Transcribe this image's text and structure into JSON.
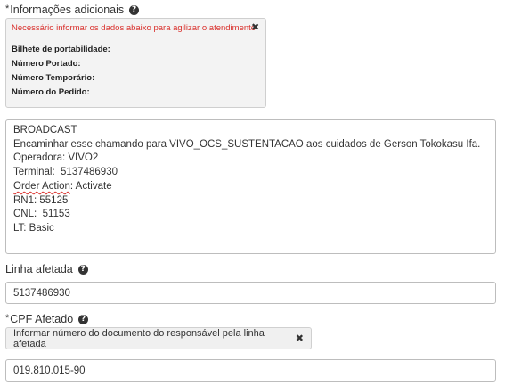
{
  "additional_info": {
    "label": "Informações adicionais",
    "required_mark": "*",
    "help_icon": "question-circle-icon",
    "warning": "Necessário informar os dados abaixo para agilizar o atendimento:",
    "close_icon": "close-icon",
    "items": [
      "Bilhete de portabilidade:",
      "Número Portado:",
      "Número Temporário:",
      "Número do Pedido:"
    ]
  },
  "description": {
    "lines": [
      "BROADCAST",
      "Encaminhar esse chamando para VIVO_OCS_SUSTENTACAO aos cuidados de Gerson Tokokasu Ifa.",
      "Operadora: VIVO2",
      "Terminal:  5137486930"
    ],
    "order_action_label": "Order Action",
    "order_action_value": ": Activate",
    "lines_after": [
      "RN1: 55125",
      "CNL:  51153",
      "LT: Basic"
    ]
  },
  "linha_afetada": {
    "label": "Linha afetada",
    "help_icon": "question-circle-icon",
    "value": "5137486930"
  },
  "cpf_afetado": {
    "label": "CPF Afetado",
    "required_mark": "*",
    "help_icon": "question-circle-icon",
    "hint": "Informar número do documento do responsável pela linha afetada",
    "close_icon": "close-icon",
    "value": "019.810.015-90"
  },
  "colors": {
    "warning": "#d9302c",
    "panel_bg": "#f3f3f3",
    "border": "#bdbdbd"
  }
}
